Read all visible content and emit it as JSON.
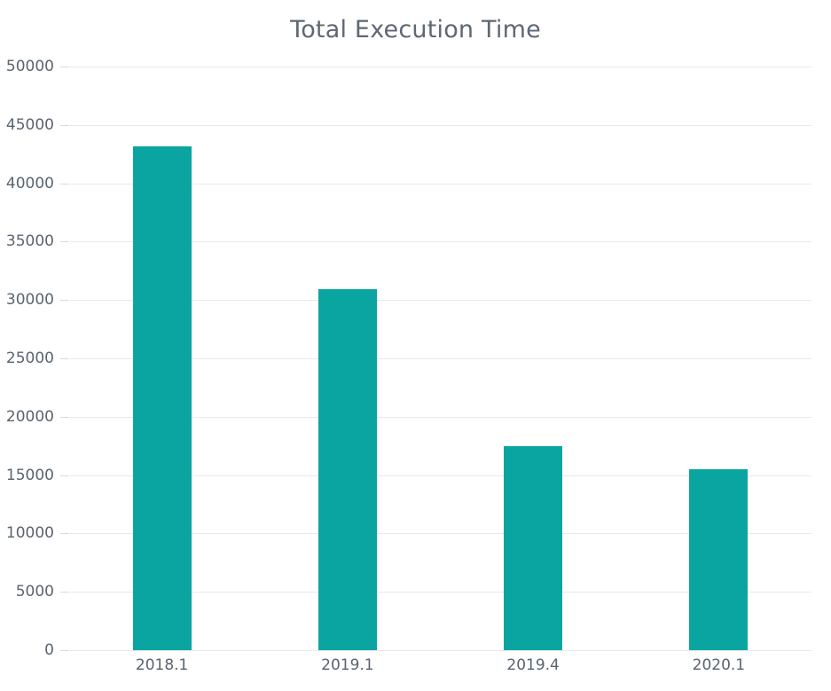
{
  "chart_data": {
    "type": "bar",
    "title": "Total Execution Time",
    "xlabel": "",
    "ylabel": "",
    "categories": [
      "2018.1",
      "2019.1",
      "2019.4",
      "2020.1"
    ],
    "values": [
      43150,
      30900,
      17500,
      15500
    ],
    "series": [
      {
        "name": "Total Execution Time",
        "values": [
          43150,
          30900,
          17500,
          15500
        ]
      }
    ],
    "ylim": [
      0,
      50000
    ],
    "yticks": [
      0,
      5000,
      10000,
      15000,
      20000,
      25000,
      30000,
      35000,
      40000,
      45000,
      50000
    ],
    "ytick_labels": [
      "0",
      "5000",
      "10000",
      "15000",
      "20000",
      "25000",
      "30000",
      "35000",
      "40000",
      "45000",
      "50000"
    ],
    "grid": true,
    "grid_axis": "y",
    "legend": false,
    "legend_position": "none",
    "bar_color": "#0ba5a1",
    "grid_color": "#e9e9e9",
    "text_color": "#59646f",
    "title_color": "#5d6875",
    "background_color": "#ffffff"
  }
}
